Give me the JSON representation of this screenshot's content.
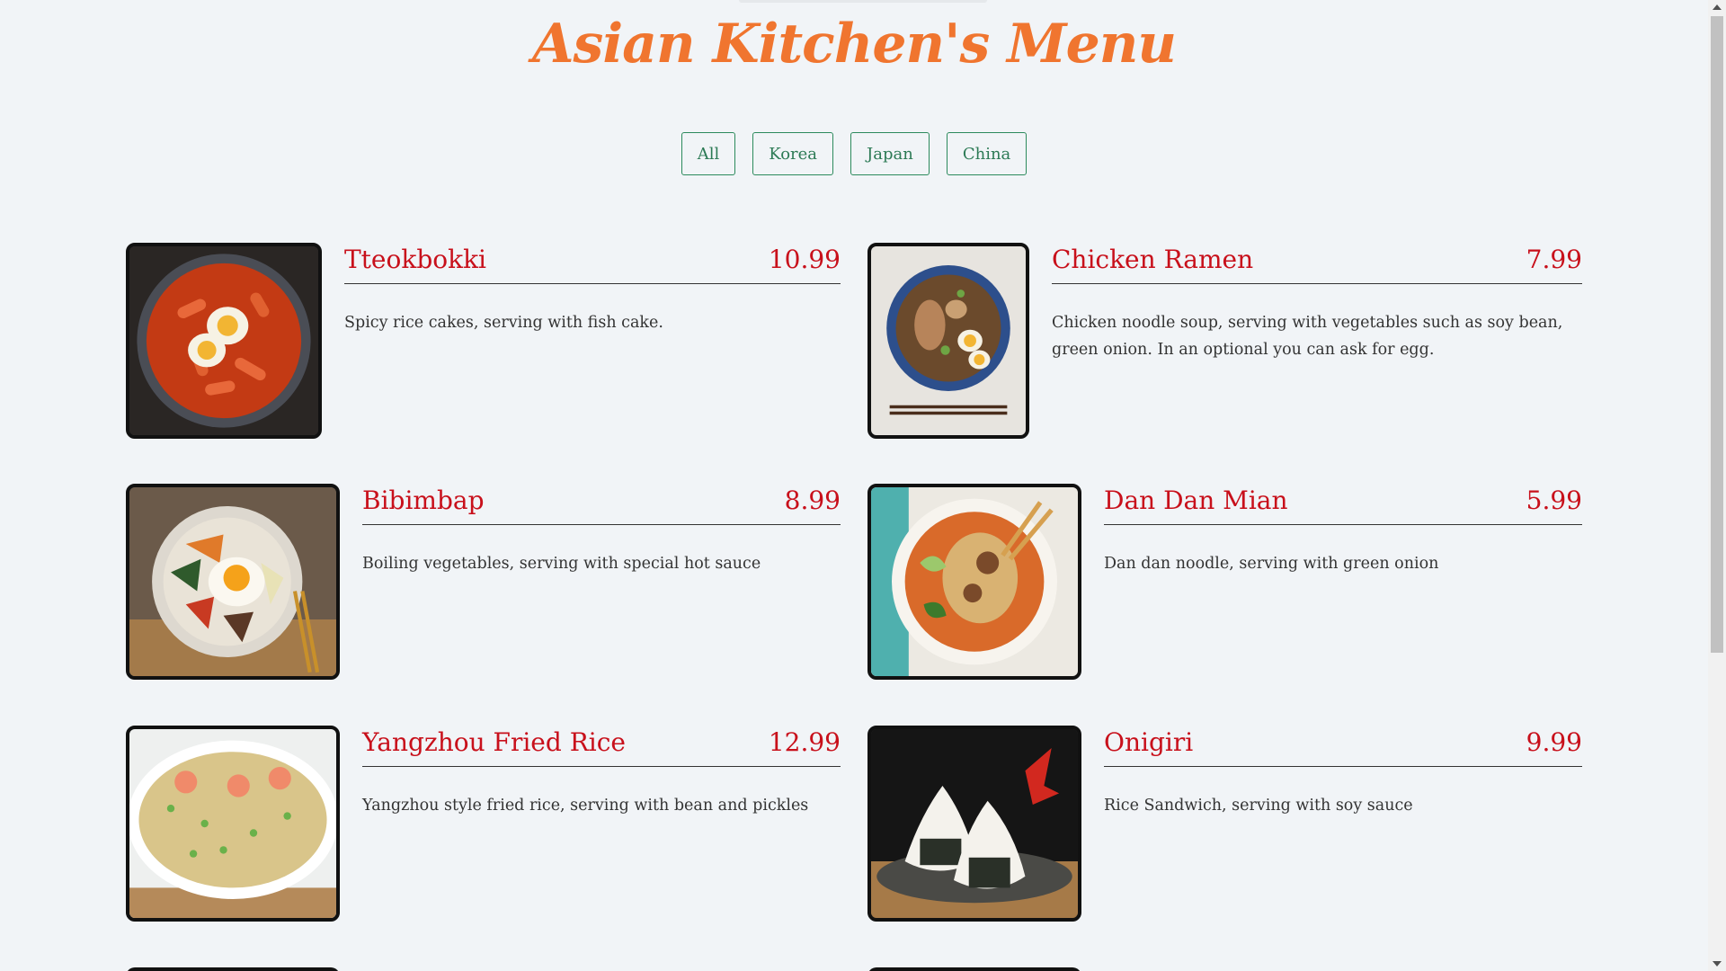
{
  "page": {
    "title": "Asian Kitchen's Menu"
  },
  "filters": [
    {
      "label": "All"
    },
    {
      "label": "Korea"
    },
    {
      "label": "Japan"
    },
    {
      "label": "China"
    }
  ],
  "menu": [
    {
      "name": "Tteokbokki",
      "price": "10.99",
      "desc": "Spicy rice cakes, serving with fish cake."
    },
    {
      "name": "Chicken Ramen",
      "price": "7.99",
      "desc": "Chicken noodle soup, serving with vegetables such as soy bean, green onion. In an optional you can ask for egg."
    },
    {
      "name": "Bibimbap",
      "price": "8.99",
      "desc": "Boiling vegetables, serving with special hot sauce"
    },
    {
      "name": "Dan Dan Mian",
      "price": "5.99",
      "desc": "Dan dan noodle, serving with green onion"
    },
    {
      "name": "Yangzhou Fried Rice",
      "price": "12.99",
      "desc": "Yangzhou style fried rice, serving with bean and pickles"
    },
    {
      "name": "Onigiri",
      "price": "9.99",
      "desc": "Rice Sandwich, serving with soy sauce"
    }
  ],
  "colors": {
    "accent": "#f0752f",
    "item_text": "#c8101b",
    "filter": "#2c8a5c"
  }
}
